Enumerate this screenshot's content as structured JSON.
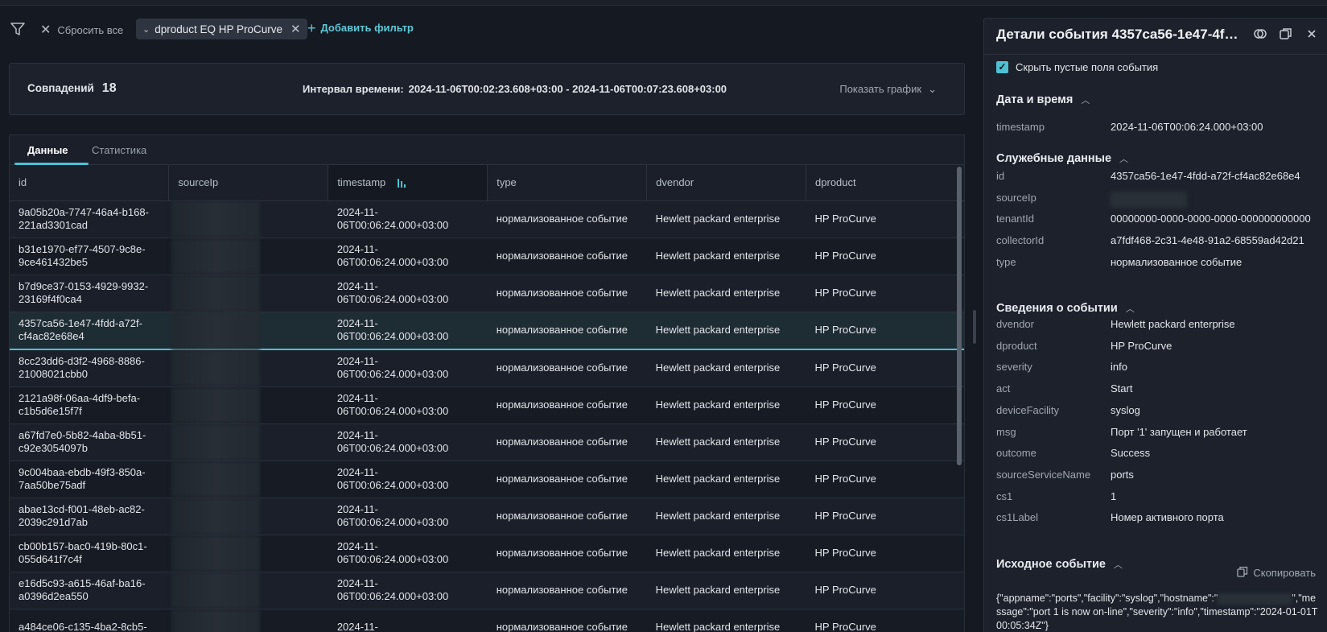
{
  "filterbar": {
    "reset_label": "Сбросить все",
    "chip_label": "dproduct EQ HP ProCurve",
    "add_filter_label": "Добавить фильтр"
  },
  "summary": {
    "matches_label": "Совпадений",
    "matches_count": "18",
    "interval_label": "Интервал времени:",
    "interval_value": "2024-11-06T00:02:23.608+03:00 - 2024-11-06T00:07:23.608+03:00",
    "show_chart_label": "Показать график"
  },
  "tabs": [
    {
      "label": "Данные"
    },
    {
      "label": "Статистика"
    }
  ],
  "table": {
    "columns": [
      "id",
      "sourceIp",
      "timestamp",
      "type",
      "dvendor",
      "dproduct"
    ],
    "rows": [
      {
        "id1": "9a05b20a-7747-46a4-b168-",
        "id2": "221ad3301cad",
        "ts1": "2024-11-",
        "ts2": "06T00:06:24.000+03:00",
        "type": "нормализованное событие",
        "dvendor": "Hewlett packard enterprise",
        "dproduct": "HP ProCurve"
      },
      {
        "id1": "b31e1970-ef77-4507-9c8e-",
        "id2": "9ce461432be5",
        "ts1": "2024-11-",
        "ts2": "06T00:06:24.000+03:00",
        "type": "нормализованное событие",
        "dvendor": "Hewlett packard enterprise",
        "dproduct": "HP ProCurve"
      },
      {
        "id1": "b7d9ce37-0153-4929-9932-",
        "id2": "23169f4f0ca4",
        "ts1": "2024-11-",
        "ts2": "06T00:06:24.000+03:00",
        "type": "нормализованное событие",
        "dvendor": "Hewlett packard enterprise",
        "dproduct": "HP ProCurve"
      },
      {
        "id1": "4357ca56-1e47-4fdd-a72f-",
        "id2": "cf4ac82e68e4",
        "ts1": "2024-11-",
        "ts2": "06T00:06:24.000+03:00",
        "type": "нормализованное событие",
        "dvendor": "Hewlett packard enterprise",
        "dproduct": "HP ProCurve"
      },
      {
        "id1": "8cc23dd6-d3f2-4968-8886-",
        "id2": "21008021cbb0",
        "ts1": "2024-11-",
        "ts2": "06T00:06:24.000+03:00",
        "type": "нормализованное событие",
        "dvendor": "Hewlett packard enterprise",
        "dproduct": "HP ProCurve"
      },
      {
        "id1": "2121a98f-06aa-4df9-befa-",
        "id2": "c1b5d6e15f7f",
        "ts1": "2024-11-",
        "ts2": "06T00:06:24.000+03:00",
        "type": "нормализованное событие",
        "dvendor": "Hewlett packard enterprise",
        "dproduct": "HP ProCurve"
      },
      {
        "id1": "a67fd7e0-5b82-4aba-8b51-",
        "id2": "c92e3054097b",
        "ts1": "2024-11-",
        "ts2": "06T00:06:24.000+03:00",
        "type": "нормализованное событие",
        "dvendor": "Hewlett packard enterprise",
        "dproduct": "HP ProCurve"
      },
      {
        "id1": "9c004baa-ebdb-49f3-850a-",
        "id2": "7aa50be75adf",
        "ts1": "2024-11-",
        "ts2": "06T00:06:24.000+03:00",
        "type": "нормализованное событие",
        "dvendor": "Hewlett packard enterprise",
        "dproduct": "HP ProCurve"
      },
      {
        "id1": "abae13cd-f001-48eb-ac82-",
        "id2": "2039c291d7ab",
        "ts1": "2024-11-",
        "ts2": "06T00:06:24.000+03:00",
        "type": "нормализованное событие",
        "dvendor": "Hewlett packard enterprise",
        "dproduct": "HP ProCurve"
      },
      {
        "id1": "cb00b157-bac0-419b-80c1-",
        "id2": "055d641f7c4f",
        "ts1": "2024-11-",
        "ts2": "06T00:06:24.000+03:00",
        "type": "нормализованное событие",
        "dvendor": "Hewlett packard enterprise",
        "dproduct": "HP ProCurve"
      },
      {
        "id1": "e16d5c93-a615-46af-ba16-",
        "id2": "a0396d2ea550",
        "ts1": "2024-11-",
        "ts2": "06T00:06:24.000+03:00",
        "type": "нормализованное событие",
        "dvendor": "Hewlett packard enterprise",
        "dproduct": "HP ProCurve"
      },
      {
        "id1": "a484ce06-c135-4ba2-8cb5-",
        "id2": "",
        "ts1": "2024-11-",
        "ts2": "",
        "type": "нормализованное событие",
        "dvendor": "Hewlett packard enterprise",
        "dproduct": "HP ProCurve"
      }
    ]
  },
  "details": {
    "title": "Детали события 4357ca56-1e47-4fd...",
    "hide_empty_label": "Скрыть пустые поля события",
    "sec_datetime": "Дата и время",
    "timestamp_key": "timestamp",
    "timestamp_val": "2024-11-06T00:06:24.000+03:00",
    "sec_service": "Служебные данные",
    "service": [
      {
        "k": "id",
        "v": "4357ca56-1e47-4fdd-a72f-cf4ac82e68e4"
      },
      {
        "k": "sourceIp",
        "v": ""
      },
      {
        "k": "tenantId",
        "v": "00000000-0000-0000-0000-000000000000"
      },
      {
        "k": "collectorId",
        "v": "a7fdf468-2c31-4e48-91a2-68559ad42d21"
      },
      {
        "k": "type",
        "v": "нормализованное событие"
      }
    ],
    "sec_event": "Сведения о событии",
    "event": [
      {
        "k": "dvendor",
        "v": "Hewlett packard enterprise"
      },
      {
        "k": "dproduct",
        "v": "HP ProCurve"
      },
      {
        "k": "severity",
        "v": "info"
      },
      {
        "k": "act",
        "v": "Start"
      },
      {
        "k": "deviceFacility",
        "v": "syslog"
      },
      {
        "k": "msg",
        "v": "Порт '1' запущен и работает"
      },
      {
        "k": "outcome",
        "v": "Success"
      },
      {
        "k": "sourceServiceName",
        "v": "ports"
      },
      {
        "k": "cs1",
        "v": "1"
      },
      {
        "k": "cs1Label",
        "v": "Номер активного порта"
      }
    ],
    "sec_raw": "Исходное событие",
    "copy_label": "Скопировать",
    "raw_part1": "{\"appname\":\"ports\",\"facility\":\"syslog\",\"hostname\":\"",
    "raw_part2": "\",\"message\":\"port 1 is now on-line\",\"severity\":\"info\",\"timestamp\":\"2024-01-01T00:05:34Z\"}"
  },
  "colors": {
    "accent": "#4ec1d3",
    "background": "#141922",
    "panel": "#1c212b"
  }
}
